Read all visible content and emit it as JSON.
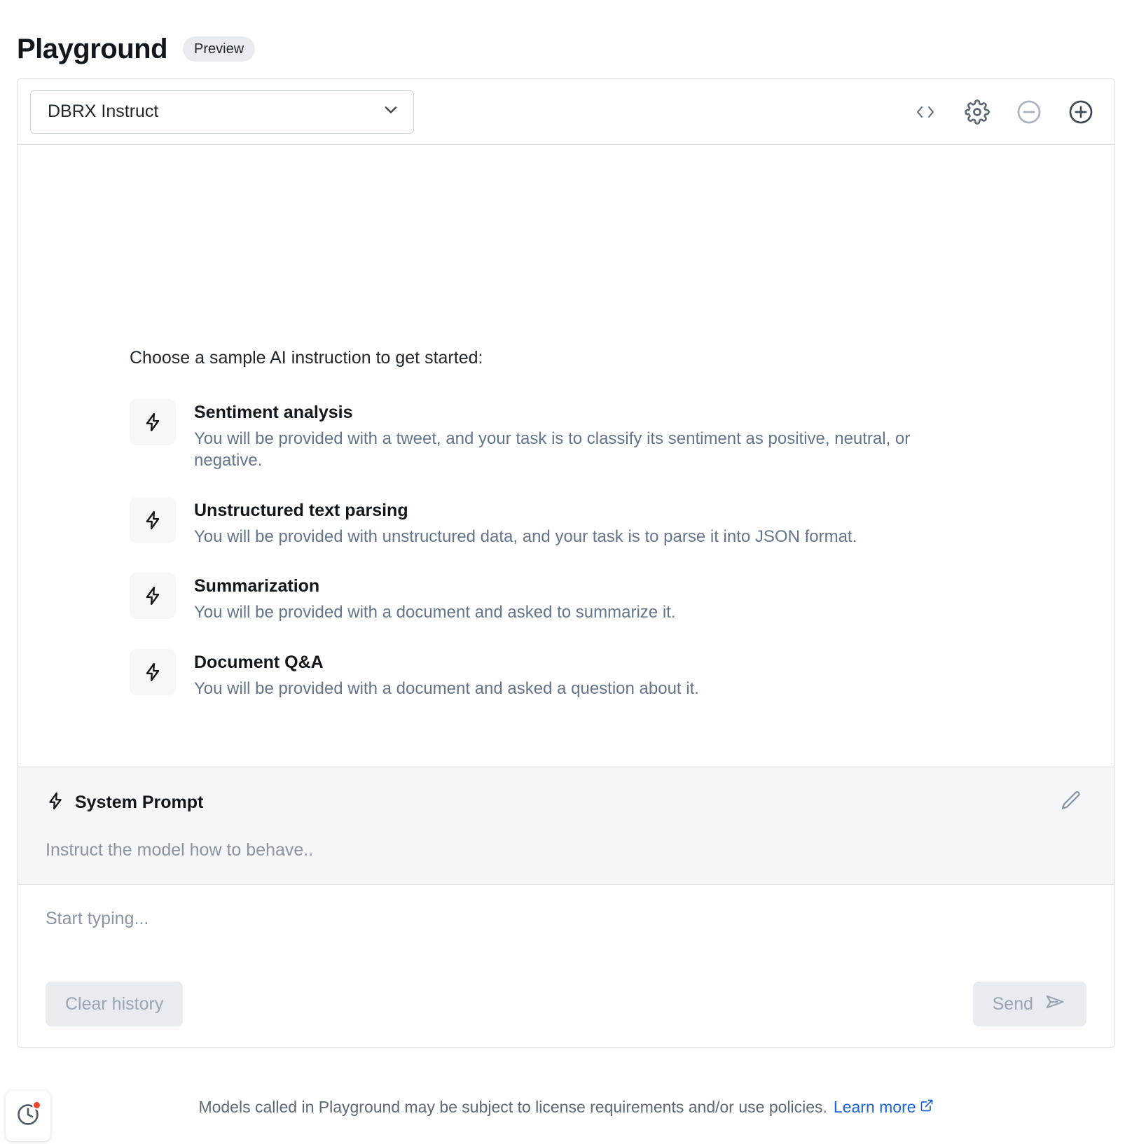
{
  "header": {
    "title": "Playground",
    "badge": "Preview"
  },
  "toolbar": {
    "model_select": {
      "value": "DBRX Instruct",
      "chevron_icon": "chevron-down-icon"
    },
    "actions": [
      {
        "name": "view-code-button",
        "icon": "code-brackets-icon"
      },
      {
        "name": "settings-button",
        "icon": "gear-icon"
      },
      {
        "name": "remove-pane-button",
        "icon": "minus-circle-icon"
      },
      {
        "name": "add-pane-button",
        "icon": "plus-circle-icon"
      }
    ]
  },
  "samples": {
    "heading": "Choose a sample AI instruction to get started:",
    "items": [
      {
        "icon": "lightning-bolt-icon",
        "title": "Sentiment analysis",
        "description": "You will be provided with a tweet, and your task is to classify its sentiment as positive, neutral, or negative."
      },
      {
        "icon": "lightning-bolt-icon",
        "title": "Unstructured text parsing",
        "description": "You will be provided with unstructured data, and your task is to parse it into JSON format."
      },
      {
        "icon": "lightning-bolt-icon",
        "title": "Summarization",
        "description": "You will be provided with a document and asked to summarize it."
      },
      {
        "icon": "lightning-bolt-icon",
        "title": "Document Q&A",
        "description": "You will be provided with a document and asked a question about it."
      }
    ]
  },
  "system_prompt": {
    "title": "System Prompt",
    "icon": "lightning-bolt-icon",
    "edit_icon": "pencil-icon",
    "placeholder": "Instruct the model how to behave.."
  },
  "composer": {
    "placeholder": "Start typing...",
    "clear_history_label": "Clear history",
    "send_label": "Send",
    "send_icon": "paper-plane-icon"
  },
  "footer": {
    "text": "Models called in Playground may be subject to license requirements and/or use policies.",
    "link_label": "Learn more",
    "link_icon": "external-link-icon",
    "history_icon": "clock-history-icon",
    "history_has_notification": true
  },
  "colors": {
    "accent_link": "#1b63d6",
    "notification_dot": "#e8452c",
    "muted_text": "#64748b",
    "panel_bg": "#f4f6f8"
  }
}
